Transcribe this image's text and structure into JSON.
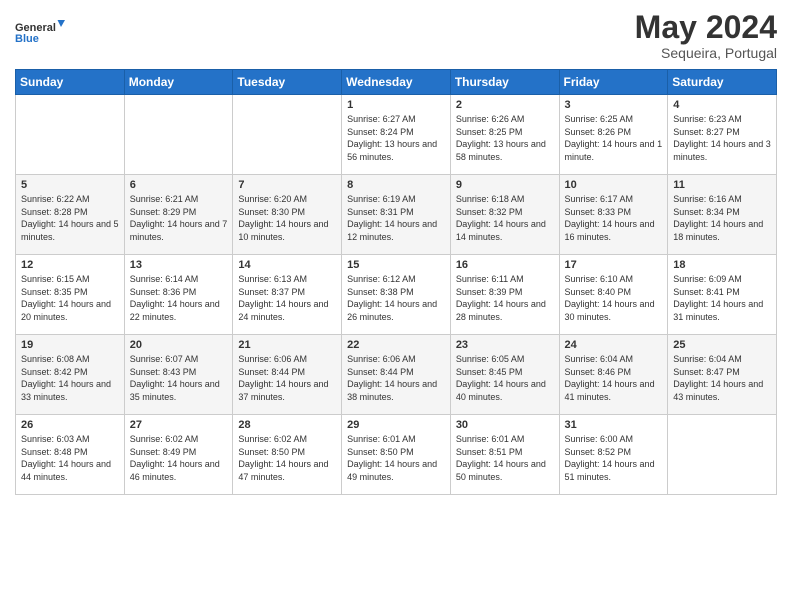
{
  "logo": {
    "line1": "General",
    "line2": "Blue"
  },
  "title": {
    "month_year": "May 2024",
    "location": "Sequeira, Portugal"
  },
  "headers": [
    "Sunday",
    "Monday",
    "Tuesday",
    "Wednesday",
    "Thursday",
    "Friday",
    "Saturday"
  ],
  "weeks": [
    [
      {
        "day": "",
        "sunrise": "",
        "sunset": "",
        "daylight": ""
      },
      {
        "day": "",
        "sunrise": "",
        "sunset": "",
        "daylight": ""
      },
      {
        "day": "",
        "sunrise": "",
        "sunset": "",
        "daylight": ""
      },
      {
        "day": "1",
        "sunrise": "Sunrise: 6:27 AM",
        "sunset": "Sunset: 8:24 PM",
        "daylight": "Daylight: 13 hours and 56 minutes."
      },
      {
        "day": "2",
        "sunrise": "Sunrise: 6:26 AM",
        "sunset": "Sunset: 8:25 PM",
        "daylight": "Daylight: 13 hours and 58 minutes."
      },
      {
        "day": "3",
        "sunrise": "Sunrise: 6:25 AM",
        "sunset": "Sunset: 8:26 PM",
        "daylight": "Daylight: 14 hours and 1 minute."
      },
      {
        "day": "4",
        "sunrise": "Sunrise: 6:23 AM",
        "sunset": "Sunset: 8:27 PM",
        "daylight": "Daylight: 14 hours and 3 minutes."
      }
    ],
    [
      {
        "day": "5",
        "sunrise": "Sunrise: 6:22 AM",
        "sunset": "Sunset: 8:28 PM",
        "daylight": "Daylight: 14 hours and 5 minutes."
      },
      {
        "day": "6",
        "sunrise": "Sunrise: 6:21 AM",
        "sunset": "Sunset: 8:29 PM",
        "daylight": "Daylight: 14 hours and 7 minutes."
      },
      {
        "day": "7",
        "sunrise": "Sunrise: 6:20 AM",
        "sunset": "Sunset: 8:30 PM",
        "daylight": "Daylight: 14 hours and 10 minutes."
      },
      {
        "day": "8",
        "sunrise": "Sunrise: 6:19 AM",
        "sunset": "Sunset: 8:31 PM",
        "daylight": "Daylight: 14 hours and 12 minutes."
      },
      {
        "day": "9",
        "sunrise": "Sunrise: 6:18 AM",
        "sunset": "Sunset: 8:32 PM",
        "daylight": "Daylight: 14 hours and 14 minutes."
      },
      {
        "day": "10",
        "sunrise": "Sunrise: 6:17 AM",
        "sunset": "Sunset: 8:33 PM",
        "daylight": "Daylight: 14 hours and 16 minutes."
      },
      {
        "day": "11",
        "sunrise": "Sunrise: 6:16 AM",
        "sunset": "Sunset: 8:34 PM",
        "daylight": "Daylight: 14 hours and 18 minutes."
      }
    ],
    [
      {
        "day": "12",
        "sunrise": "Sunrise: 6:15 AM",
        "sunset": "Sunset: 8:35 PM",
        "daylight": "Daylight: 14 hours and 20 minutes."
      },
      {
        "day": "13",
        "sunrise": "Sunrise: 6:14 AM",
        "sunset": "Sunset: 8:36 PM",
        "daylight": "Daylight: 14 hours and 22 minutes."
      },
      {
        "day": "14",
        "sunrise": "Sunrise: 6:13 AM",
        "sunset": "Sunset: 8:37 PM",
        "daylight": "Daylight: 14 hours and 24 minutes."
      },
      {
        "day": "15",
        "sunrise": "Sunrise: 6:12 AM",
        "sunset": "Sunset: 8:38 PM",
        "daylight": "Daylight: 14 hours and 26 minutes."
      },
      {
        "day": "16",
        "sunrise": "Sunrise: 6:11 AM",
        "sunset": "Sunset: 8:39 PM",
        "daylight": "Daylight: 14 hours and 28 minutes."
      },
      {
        "day": "17",
        "sunrise": "Sunrise: 6:10 AM",
        "sunset": "Sunset: 8:40 PM",
        "daylight": "Daylight: 14 hours and 30 minutes."
      },
      {
        "day": "18",
        "sunrise": "Sunrise: 6:09 AM",
        "sunset": "Sunset: 8:41 PM",
        "daylight": "Daylight: 14 hours and 31 minutes."
      }
    ],
    [
      {
        "day": "19",
        "sunrise": "Sunrise: 6:08 AM",
        "sunset": "Sunset: 8:42 PM",
        "daylight": "Daylight: 14 hours and 33 minutes."
      },
      {
        "day": "20",
        "sunrise": "Sunrise: 6:07 AM",
        "sunset": "Sunset: 8:43 PM",
        "daylight": "Daylight: 14 hours and 35 minutes."
      },
      {
        "day": "21",
        "sunrise": "Sunrise: 6:06 AM",
        "sunset": "Sunset: 8:44 PM",
        "daylight": "Daylight: 14 hours and 37 minutes."
      },
      {
        "day": "22",
        "sunrise": "Sunrise: 6:06 AM",
        "sunset": "Sunset: 8:44 PM",
        "daylight": "Daylight: 14 hours and 38 minutes."
      },
      {
        "day": "23",
        "sunrise": "Sunrise: 6:05 AM",
        "sunset": "Sunset: 8:45 PM",
        "daylight": "Daylight: 14 hours and 40 minutes."
      },
      {
        "day": "24",
        "sunrise": "Sunrise: 6:04 AM",
        "sunset": "Sunset: 8:46 PM",
        "daylight": "Daylight: 14 hours and 41 minutes."
      },
      {
        "day": "25",
        "sunrise": "Sunrise: 6:04 AM",
        "sunset": "Sunset: 8:47 PM",
        "daylight": "Daylight: 14 hours and 43 minutes."
      }
    ],
    [
      {
        "day": "26",
        "sunrise": "Sunrise: 6:03 AM",
        "sunset": "Sunset: 8:48 PM",
        "daylight": "Daylight: 14 hours and 44 minutes."
      },
      {
        "day": "27",
        "sunrise": "Sunrise: 6:02 AM",
        "sunset": "Sunset: 8:49 PM",
        "daylight": "Daylight: 14 hours and 46 minutes."
      },
      {
        "day": "28",
        "sunrise": "Sunrise: 6:02 AM",
        "sunset": "Sunset: 8:50 PM",
        "daylight": "Daylight: 14 hours and 47 minutes."
      },
      {
        "day": "29",
        "sunrise": "Sunrise: 6:01 AM",
        "sunset": "Sunset: 8:50 PM",
        "daylight": "Daylight: 14 hours and 49 minutes."
      },
      {
        "day": "30",
        "sunrise": "Sunrise: 6:01 AM",
        "sunset": "Sunset: 8:51 PM",
        "daylight": "Daylight: 14 hours and 50 minutes."
      },
      {
        "day": "31",
        "sunrise": "Sunrise: 6:00 AM",
        "sunset": "Sunset: 8:52 PM",
        "daylight": "Daylight: 14 hours and 51 minutes."
      },
      {
        "day": "",
        "sunrise": "",
        "sunset": "",
        "daylight": ""
      }
    ]
  ]
}
